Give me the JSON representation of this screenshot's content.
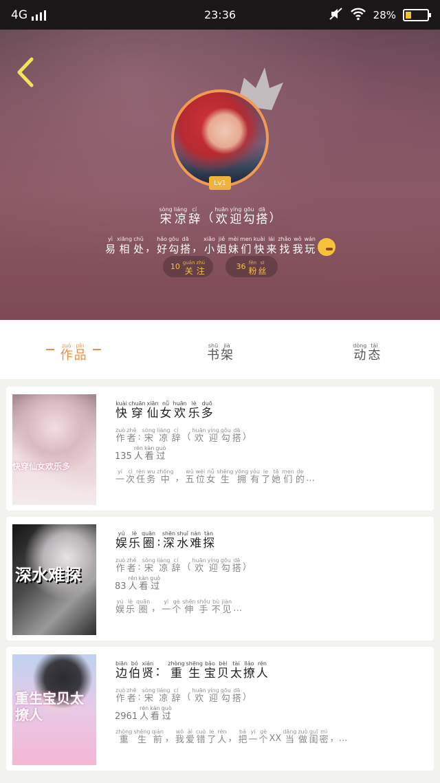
{
  "status_bar": {
    "network": "4G",
    "time": "23:36",
    "battery_percent": "28%",
    "battery_level": 0.28
  },
  "profile": {
    "username": [
      {
        "py": "sòng",
        "ch": "宋"
      },
      {
        "py": "liáng",
        "ch": "凉"
      },
      {
        "py": "cí",
        "ch": "辞"
      },
      {
        "py": "",
        "ch": "（"
      },
      {
        "py": "huān",
        "ch": "欢"
      },
      {
        "py": "yíng",
        "ch": "迎"
      },
      {
        "py": "gōu",
        "ch": "勾"
      },
      {
        "py": "dā",
        "ch": "搭"
      },
      {
        "py": "",
        "ch": "）"
      }
    ],
    "bio": [
      {
        "py": "yì",
        "ch": "易"
      },
      {
        "py": "xiāng",
        "ch": "相"
      },
      {
        "py": "chǔ",
        "ch": "处"
      },
      {
        "py": "",
        "ch": "，"
      },
      {
        "py": "hǎo",
        "ch": "好"
      },
      {
        "py": "gōu",
        "ch": "勾"
      },
      {
        "py": "dā",
        "ch": "搭"
      },
      {
        "py": "",
        "ch": "，"
      },
      {
        "py": "xiǎo",
        "ch": "小"
      },
      {
        "py": "jiě",
        "ch": "姐"
      },
      {
        "py": "mèi",
        "ch": "妹"
      },
      {
        "py": "men",
        "ch": "们"
      },
      {
        "py": "kuài",
        "ch": "快"
      },
      {
        "py": "lái",
        "ch": "来"
      },
      {
        "py": "zhǎo",
        "ch": "找"
      },
      {
        "py": "wǒ",
        "ch": "我"
      },
      {
        "py": "wán",
        "ch": "玩"
      }
    ],
    "level": "Lv1",
    "following": {
      "count": "10",
      "label": [
        {
          "py": "guān",
          "ch": "关"
        },
        {
          "py": "zhù",
          "ch": "注"
        }
      ]
    },
    "followers": {
      "count": "36",
      "label": [
        {
          "py": "fěn",
          "ch": "粉"
        },
        {
          "py": "sī",
          "ch": "丝"
        }
      ]
    }
  },
  "tabs": [
    {
      "label": [
        {
          "py": "zuò",
          "ch": "作"
        },
        {
          "py": "pǐn",
          "ch": "品"
        }
      ],
      "active": true
    },
    {
      "label": [
        {
          "py": "shū",
          "ch": "书"
        },
        {
          "py": "jià",
          "ch": "架"
        }
      ],
      "active": false
    },
    {
      "label": [
        {
          "py": "dòng",
          "ch": "动"
        },
        {
          "py": "tài",
          "ch": "态"
        }
      ],
      "active": false
    }
  ],
  "works": [
    {
      "title": [
        {
          "py": "kuài",
          "ch": "快"
        },
        {
          "py": "chuān",
          "ch": "穿"
        },
        {
          "py": "xiān",
          "ch": "仙"
        },
        {
          "py": "nǚ",
          "ch": "女"
        },
        {
          "py": "huān",
          "ch": "欢"
        },
        {
          "py": "lè",
          "ch": "乐"
        },
        {
          "py": "duō",
          "ch": "多"
        }
      ],
      "author": [
        {
          "py": "zuò",
          "ch": "作"
        },
        {
          "py": "zhě",
          "ch": "者"
        },
        {
          "py": "",
          "ch": ":"
        },
        {
          "py": "sòng",
          "ch": "宋"
        },
        {
          "py": "liáng",
          "ch": "凉"
        },
        {
          "py": "cí",
          "ch": "辞"
        },
        {
          "py": "",
          "ch": "（"
        },
        {
          "py": "huān",
          "ch": "欢"
        },
        {
          "py": "yíng",
          "ch": "迎"
        },
        {
          "py": "gōu",
          "ch": "勾"
        },
        {
          "py": "dā",
          "ch": "搭"
        },
        {
          "py": "",
          "ch": "）"
        }
      ],
      "views_count": "135",
      "views_label": [
        {
          "py": "rén",
          "ch": "人"
        },
        {
          "py": "kàn",
          "ch": "看"
        },
        {
          "py": "guò",
          "ch": "过"
        }
      ],
      "description": [
        {
          "py": "yí",
          "ch": "一"
        },
        {
          "py": "cì",
          "ch": "次"
        },
        {
          "py": "rèn",
          "ch": "任"
        },
        {
          "py": "wu",
          "ch": "务"
        },
        {
          "py": "zhōng",
          "ch": "中"
        },
        {
          "py": "",
          "ch": "，"
        },
        {
          "py": "wǔ",
          "ch": "五"
        },
        {
          "py": "wèi",
          "ch": "位"
        },
        {
          "py": "nǚ",
          "ch": "女"
        },
        {
          "py": "shēng",
          "ch": "生"
        },
        {
          "py": "yōng",
          "ch": "拥"
        },
        {
          "py": "yǒu",
          "ch": "有"
        },
        {
          "py": "le",
          "ch": "了"
        },
        {
          "py": "tā",
          "ch": "她"
        },
        {
          "py": "men",
          "ch": "们"
        },
        {
          "py": "de",
          "ch": "的"
        },
        {
          "py": "",
          "ch": "…"
        }
      ],
      "cover_text": "快穿仙女欢乐多"
    },
    {
      "title": [
        {
          "py": "yú",
          "ch": "娱"
        },
        {
          "py": "lè",
          "ch": "乐"
        },
        {
          "py": "quān",
          "ch": "圈"
        },
        {
          "py": "",
          "ch": ":"
        },
        {
          "py": "shēn",
          "ch": "深"
        },
        {
          "py": "shuǐ",
          "ch": "水"
        },
        {
          "py": "nán",
          "ch": "难"
        },
        {
          "py": "tàn",
          "ch": "探"
        }
      ],
      "author": [
        {
          "py": "zuò",
          "ch": "作"
        },
        {
          "py": "zhě",
          "ch": "者"
        },
        {
          "py": "",
          "ch": ":"
        },
        {
          "py": "sòng",
          "ch": "宋"
        },
        {
          "py": "liáng",
          "ch": "凉"
        },
        {
          "py": "cí",
          "ch": "辞"
        },
        {
          "py": "",
          "ch": "（"
        },
        {
          "py": "huān",
          "ch": "欢"
        },
        {
          "py": "yíng",
          "ch": "迎"
        },
        {
          "py": "gōu",
          "ch": "勾"
        },
        {
          "py": "dā",
          "ch": "搭"
        },
        {
          "py": "",
          "ch": "）"
        }
      ],
      "views_count": "83",
      "views_label": [
        {
          "py": "rén",
          "ch": "人"
        },
        {
          "py": "kàn",
          "ch": "看"
        },
        {
          "py": "guò",
          "ch": "过"
        }
      ],
      "description": [
        {
          "py": "yú",
          "ch": "娱"
        },
        {
          "py": "lè",
          "ch": "乐"
        },
        {
          "py": "quān",
          "ch": "圈"
        },
        {
          "py": "",
          "ch": "，"
        },
        {
          "py": "yí",
          "ch": "一"
        },
        {
          "py": "gè",
          "ch": "个"
        },
        {
          "py": "shēn",
          "ch": "伸"
        },
        {
          "py": "shǒu",
          "ch": "手"
        },
        {
          "py": "bù",
          "ch": "不"
        },
        {
          "py": "jiàn",
          "ch": "见"
        },
        {
          "py": "",
          "ch": "…"
        }
      ],
      "cover_text": "深水难探"
    },
    {
      "title": [
        {
          "py": "biān",
          "ch": "边"
        },
        {
          "py": "bó",
          "ch": "伯"
        },
        {
          "py": "xián",
          "ch": "贤"
        },
        {
          "py": "",
          "ch": "："
        },
        {
          "py": "zhòng",
          "ch": "重"
        },
        {
          "py": "shēng",
          "ch": "生"
        },
        {
          "py": "bǎo",
          "ch": "宝"
        },
        {
          "py": "bèi",
          "ch": "贝"
        },
        {
          "py": "tài",
          "ch": "太"
        },
        {
          "py": "liáo",
          "ch": "撩"
        },
        {
          "py": "rén",
          "ch": "人"
        }
      ],
      "author": [
        {
          "py": "zuò",
          "ch": "作"
        },
        {
          "py": "zhě",
          "ch": "者"
        },
        {
          "py": "",
          "ch": ":"
        },
        {
          "py": "sòng",
          "ch": "宋"
        },
        {
          "py": "liáng",
          "ch": "凉"
        },
        {
          "py": "cí",
          "ch": "辞"
        },
        {
          "py": "",
          "ch": "（"
        },
        {
          "py": "huān",
          "ch": "欢"
        },
        {
          "py": "yíng",
          "ch": "迎"
        },
        {
          "py": "gōu",
          "ch": "勾"
        },
        {
          "py": "dā",
          "ch": "搭"
        },
        {
          "py": "",
          "ch": "）"
        }
      ],
      "views_count": "2961",
      "views_label": [
        {
          "py": "rén",
          "ch": "人"
        },
        {
          "py": "kàn",
          "ch": "看"
        },
        {
          "py": "guò",
          "ch": "过"
        }
      ],
      "description": [
        {
          "py": "zhòng",
          "ch": "重"
        },
        {
          "py": "shēng",
          "ch": "生"
        },
        {
          "py": "qián",
          "ch": "前"
        },
        {
          "py": "",
          "ch": "，"
        },
        {
          "py": "wǒ",
          "ch": "我"
        },
        {
          "py": "ài",
          "ch": "爱"
        },
        {
          "py": "cuò",
          "ch": "错"
        },
        {
          "py": "le",
          "ch": "了"
        },
        {
          "py": "rén",
          "ch": "人"
        },
        {
          "py": "",
          "ch": "，"
        },
        {
          "py": "bǎ",
          "ch": "把"
        },
        {
          "py": "yí",
          "ch": "一"
        },
        {
          "py": "gè",
          "ch": "个"
        },
        {
          "py": "",
          "ch": "XX"
        },
        {
          "py": "dāng",
          "ch": "当"
        },
        {
          "py": "zuò",
          "ch": "做"
        },
        {
          "py": "guī",
          "ch": "闺"
        },
        {
          "py": "mì",
          "ch": "密"
        },
        {
          "py": "",
          "ch": "，…"
        }
      ],
      "cover_text": "重生宝贝太撩人"
    }
  ],
  "icons": {
    "back": "back-arrow-icon",
    "crown": "crown-icon",
    "wifi": "wifi-icon",
    "mute": "mute-icon",
    "signal": "signal-icon",
    "battery": "battery-icon",
    "emoji": "tongue-out-emoji-icon"
  },
  "colors": {
    "accent": "#f08b3f",
    "stat_text": "#f2c14d",
    "back_arrow": "#f3e25a"
  }
}
